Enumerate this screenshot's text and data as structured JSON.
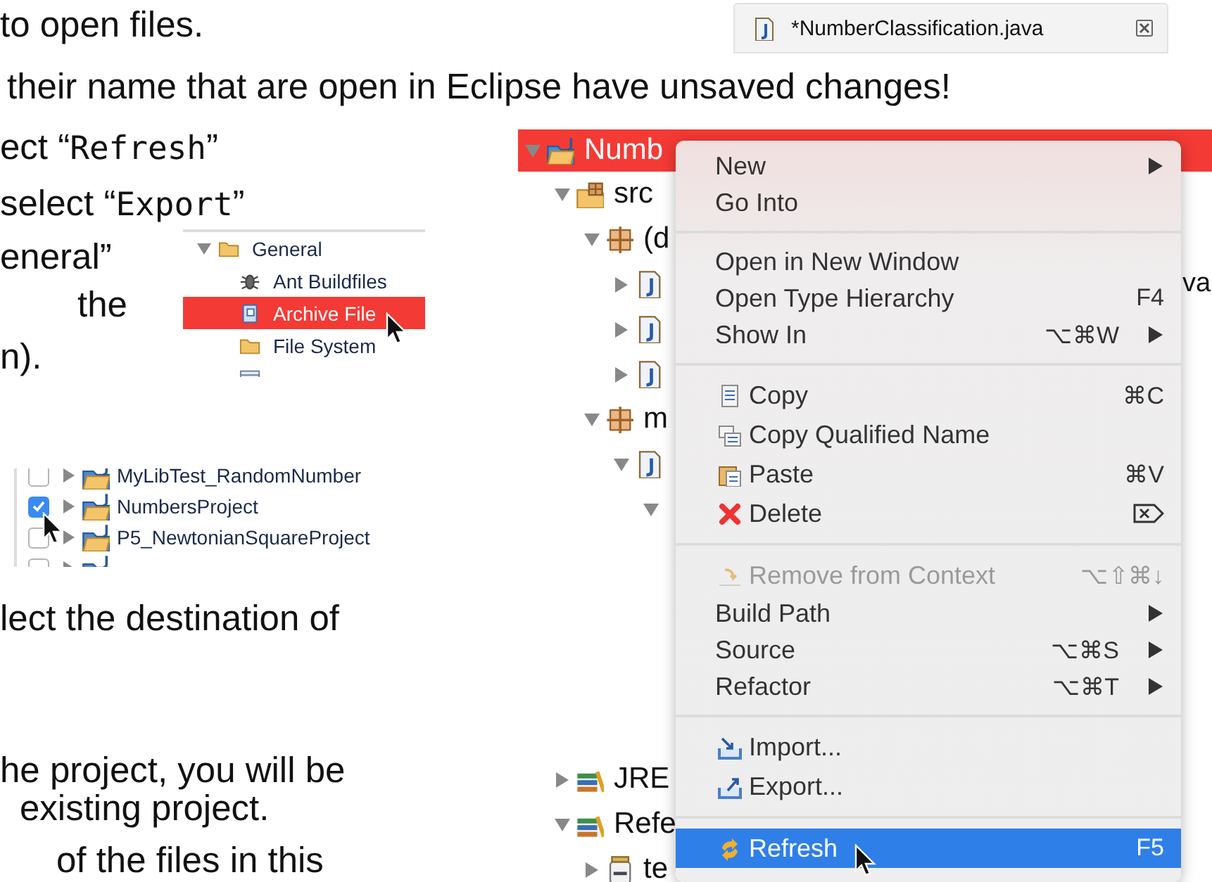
{
  "text_lines": [
    {
      "parts": [
        {
          "kind": "plain",
          "text": "to open files."
        }
      ]
    },
    {
      "parts": [
        {
          "kind": "plain",
          "text": "their name that are open in Eclipse have unsaved changes!"
        }
      ]
    },
    {
      "parts": [
        {
          "kind": "plain",
          "text": "ect “"
        },
        {
          "kind": "code",
          "text": "Refresh"
        },
        {
          "kind": "plain",
          "text": "”"
        }
      ]
    },
    {
      "parts": [
        {
          "kind": "plain",
          "text": "select “"
        },
        {
          "kind": "code",
          "text": "Export"
        },
        {
          "kind": "plain",
          "text": "”"
        }
      ]
    },
    {
      "parts": [
        {
          "kind": "plain",
          "text": "eneral”"
        }
      ]
    },
    {
      "parts": [
        {
          "kind": "plain",
          "text": "the"
        }
      ]
    },
    {
      "parts": [
        {
          "kind": "plain",
          "text": "n)."
        }
      ]
    },
    {
      "parts": [
        {
          "kind": "plain",
          "text": "lect the destination of"
        }
      ]
    },
    {
      "parts": [
        {
          "kind": "plain",
          "text": "he project, you will be"
        }
      ]
    },
    {
      "parts": [
        {
          "kind": "plain",
          "text": "existing project."
        }
      ]
    },
    {
      "parts": [
        {
          "kind": "plain",
          "text": "of the files in this"
        }
      ]
    }
  ],
  "editor_tab": {
    "title": "*NumberClassification.java"
  },
  "export_wizard_tree": [
    {
      "label": "General",
      "kind": "folder",
      "expanded": true,
      "selected": false,
      "children": [
        {
          "label": "Ant Buildfiles",
          "kind": "ant",
          "selected": false
        },
        {
          "label": "Archive File",
          "kind": "archive",
          "selected": true
        },
        {
          "label": "File System",
          "kind": "folder",
          "selected": false
        },
        {
          "kind": "preferences",
          "selected": false
        }
      ]
    }
  ],
  "project_list": [
    {
      "label": "MyLibTest_RandomNumber",
      "checked": false
    },
    {
      "label": "NumbersProject",
      "checked": true
    },
    {
      "label": "P5_NewtonianSquareProject",
      "checked": false
    },
    {
      "checked": false
    }
  ],
  "package_explorer": [
    {
      "label": "Numb",
      "kind": "project",
      "expanded": true,
      "selected": true,
      "children": [
        {
          "label": "src",
          "kind": "source-folder",
          "expanded": true,
          "selected": false,
          "children": [
            {
              "label": "(d",
              "kind": "package",
              "expanded": true,
              "selected": false,
              "children": [
                {
                  "label_tail": "va",
                  "kind": "java-file",
                  "expanded": false,
                  "selected": false
                },
                {
                  "kind": "java-file",
                  "expanded": false,
                  "selected": false
                },
                {
                  "kind": "java-file",
                  "expanded": false,
                  "selected": false
                }
              ]
            },
            {
              "label": "m",
              "kind": "package",
              "expanded": true,
              "selected": false,
              "children": [
                {
                  "kind": "java-file",
                  "expanded": true,
                  "selected": false,
                  "children": [
                    {
                      "expanded": true,
                      "selected": false
                    }
                  ]
                }
              ]
            }
          ]
        },
        {
          "label": "JRE",
          "kind": "library",
          "expanded": false,
          "selected": false
        },
        {
          "label": "Refe",
          "kind": "library",
          "expanded": true,
          "selected": false,
          "children": [
            {
              "label": "te",
              "kind": "jar",
              "expanded": false,
              "selected": false
            }
          ]
        }
      ]
    }
  ],
  "context_menu": [
    {
      "kind": "plain",
      "label": "New",
      "submenu": true,
      "disabled": false,
      "selected": false
    },
    {
      "kind": "plain",
      "label": "Go Into",
      "submenu": false,
      "disabled": false,
      "selected": false
    },
    {
      "kind": "separator"
    },
    {
      "kind": "plain",
      "label": "Open in New Window",
      "submenu": false,
      "disabled": false,
      "selected": false
    },
    {
      "kind": "plain",
      "label": "Open Type Hierarchy",
      "shortcut": "F4",
      "submenu": false,
      "disabled": false,
      "selected": false
    },
    {
      "kind": "plain",
      "label": "Show In",
      "shortcut": "⌥⌘W",
      "submenu": true,
      "disabled": false,
      "selected": false
    },
    {
      "kind": "separator"
    },
    {
      "kind": "copy",
      "label": "Copy",
      "shortcut": "⌘C",
      "submenu": false,
      "disabled": false,
      "selected": false
    },
    {
      "kind": "copy-name",
      "label": "Copy Qualified Name",
      "submenu": false,
      "disabled": false,
      "selected": false
    },
    {
      "kind": "paste",
      "label": "Paste",
      "shortcut": "⌘V",
      "submenu": false,
      "disabled": false,
      "selected": false
    },
    {
      "kind": "delete",
      "label": "Delete",
      "submenu": false,
      "disabled": false,
      "selected": false
    },
    {
      "kind": "separator"
    },
    {
      "kind": "remove",
      "label": "Remove from Context",
      "shortcut": "⌥⇧⌘↓",
      "submenu": false,
      "disabled": true,
      "selected": false
    },
    {
      "kind": "plain",
      "label": "Build Path",
      "submenu": true,
      "disabled": false,
      "selected": false
    },
    {
      "kind": "plain",
      "label": "Source",
      "shortcut": "⌥⌘S",
      "submenu": true,
      "disabled": false,
      "selected": false
    },
    {
      "kind": "plain",
      "label": "Refactor",
      "shortcut": "⌥⌘T",
      "submenu": true,
      "disabled": false,
      "selected": false
    },
    {
      "kind": "separator"
    },
    {
      "kind": "import",
      "label": "Import...",
      "submenu": false,
      "disabled": false,
      "selected": false
    },
    {
      "kind": "export",
      "label": "Export...",
      "submenu": false,
      "disabled": false,
      "selected": false
    },
    {
      "kind": "separator"
    },
    {
      "kind": "refresh",
      "label": "Refresh",
      "shortcut": "F5",
      "submenu": false,
      "disabled": false,
      "selected": true
    }
  ]
}
